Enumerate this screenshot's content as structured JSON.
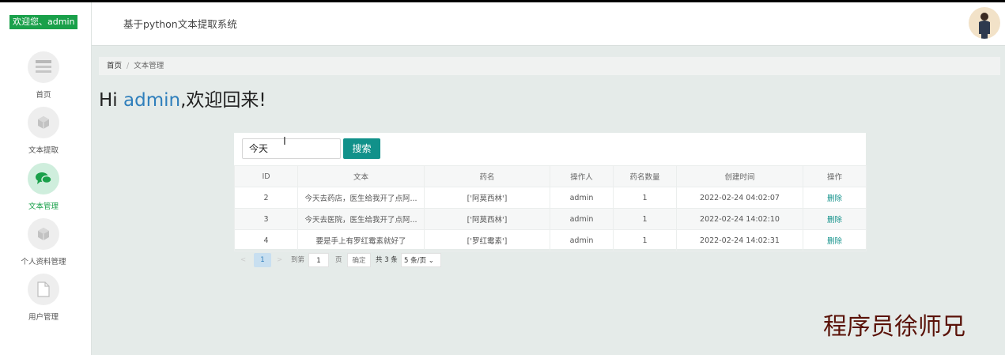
{
  "sidebar": {
    "welcome": "欢迎您、admin",
    "items": [
      {
        "label": "首页",
        "icon": "home-list-icon"
      },
      {
        "label": "文本提取",
        "icon": "cube-icon"
      },
      {
        "label": "文本管理",
        "icon": "chat-icon",
        "active": true
      },
      {
        "label": "个人资料管理",
        "icon": "cube-icon"
      },
      {
        "label": "用户管理",
        "icon": "document-icon"
      }
    ]
  },
  "header": {
    "title": "基于python文本提取系统"
  },
  "breadcrumb": {
    "home": "首页",
    "separator": "/",
    "current": "文本管理"
  },
  "greeting": {
    "prefix": "Hi ",
    "user": "admin",
    "suffix": ",欢迎回来!"
  },
  "search": {
    "value": "今天",
    "button": "搜索"
  },
  "table": {
    "columns": [
      "ID",
      "文本",
      "药名",
      "操作人",
      "药名数量",
      "创建时间",
      "操作"
    ],
    "rows": [
      {
        "id": "2",
        "text": "今天去药店，医生给我开了点阿...",
        "drug": "['阿莫西林']",
        "operator": "admin",
        "count": "1",
        "created": "2022-02-24 04:02:07",
        "action": "删除"
      },
      {
        "id": "3",
        "text": "今天去医院，医生给我开了点阿...",
        "drug": "['阿莫西林']",
        "operator": "admin",
        "count": "1",
        "created": "2022-02-24 14:02:10",
        "action": "删除"
      },
      {
        "id": "4",
        "text": "要是手上有罗红霉素就好了",
        "drug": "['罗红霉素']",
        "operator": "admin",
        "count": "1",
        "created": "2022-02-24 14:02:31",
        "action": "删除"
      }
    ]
  },
  "pagination": {
    "prev": "<",
    "current_page": "1",
    "next": ">",
    "goto_label": "到第",
    "goto_value": "1",
    "page_label": "页",
    "confirm": "确定",
    "total": "共 3 条",
    "page_size": "5 条/页"
  },
  "watermark": "程序员徐师兄",
  "colors": {
    "accent": "#19a04a",
    "teal": "#11918a",
    "link_blue": "#2f7fbc"
  }
}
